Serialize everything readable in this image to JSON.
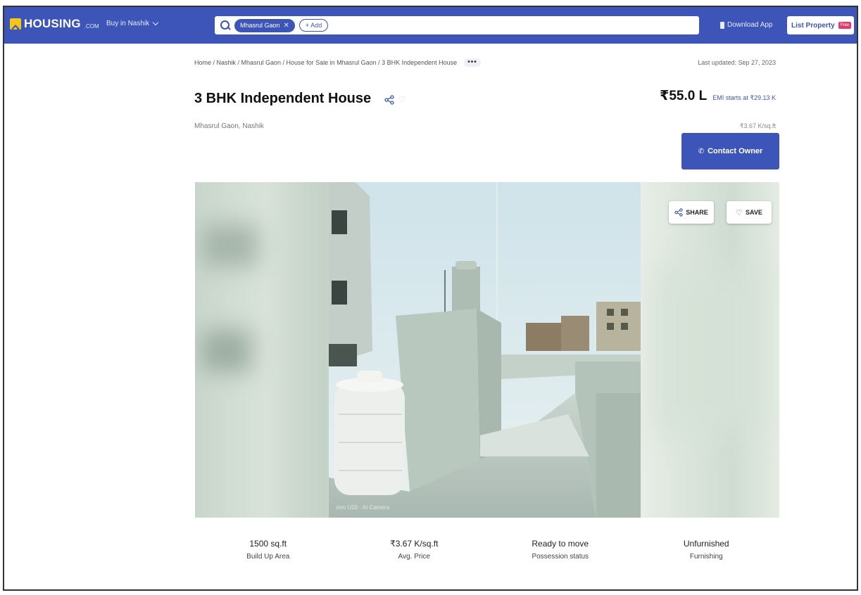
{
  "nav": {
    "logo_text": "HOUSING",
    "logo_suffix": ".COM",
    "buy_in_label": "Buy in Nashik",
    "search_chip": "Mhasrul Gaon",
    "add_label": "+ Add",
    "download_app": "Download App",
    "list_property": "List Property",
    "free_badge": "Free"
  },
  "breadcrumb": {
    "path": "Home / Nashik / Mhasrul Gaon / House for Sale in Mhasrul Gaon / 3 BHK Independent House",
    "more": "•••"
  },
  "last_updated": "Last updated: Sep 27, 2023",
  "property": {
    "title": "3 BHK Independent House",
    "locality": "Mhasrul Gaon, Nashik",
    "price": "₹55.0 L",
    "emi": "EMI starts at ₹29.13 K",
    "per_sqft": "₹3.67 K/sq.ft"
  },
  "contact_button": "Contact Owner",
  "gallery": {
    "share_label": "SHARE",
    "save_label": "SAVE",
    "photo_caption": "vivo U20 · AI Camera"
  },
  "stats": [
    {
      "value": "1500 sq.ft",
      "label": "Build Up Area"
    },
    {
      "value": "₹3.67 K/sq.ft",
      "label": "Avg. Price"
    },
    {
      "value": "Ready to move",
      "label": "Possession status"
    },
    {
      "value": "Unfurnished",
      "label": "Furnishing"
    }
  ],
  "colors": {
    "brand": "#3d55b9",
    "badge": "#e33c6c",
    "logo_yellow": "#f5c518"
  }
}
